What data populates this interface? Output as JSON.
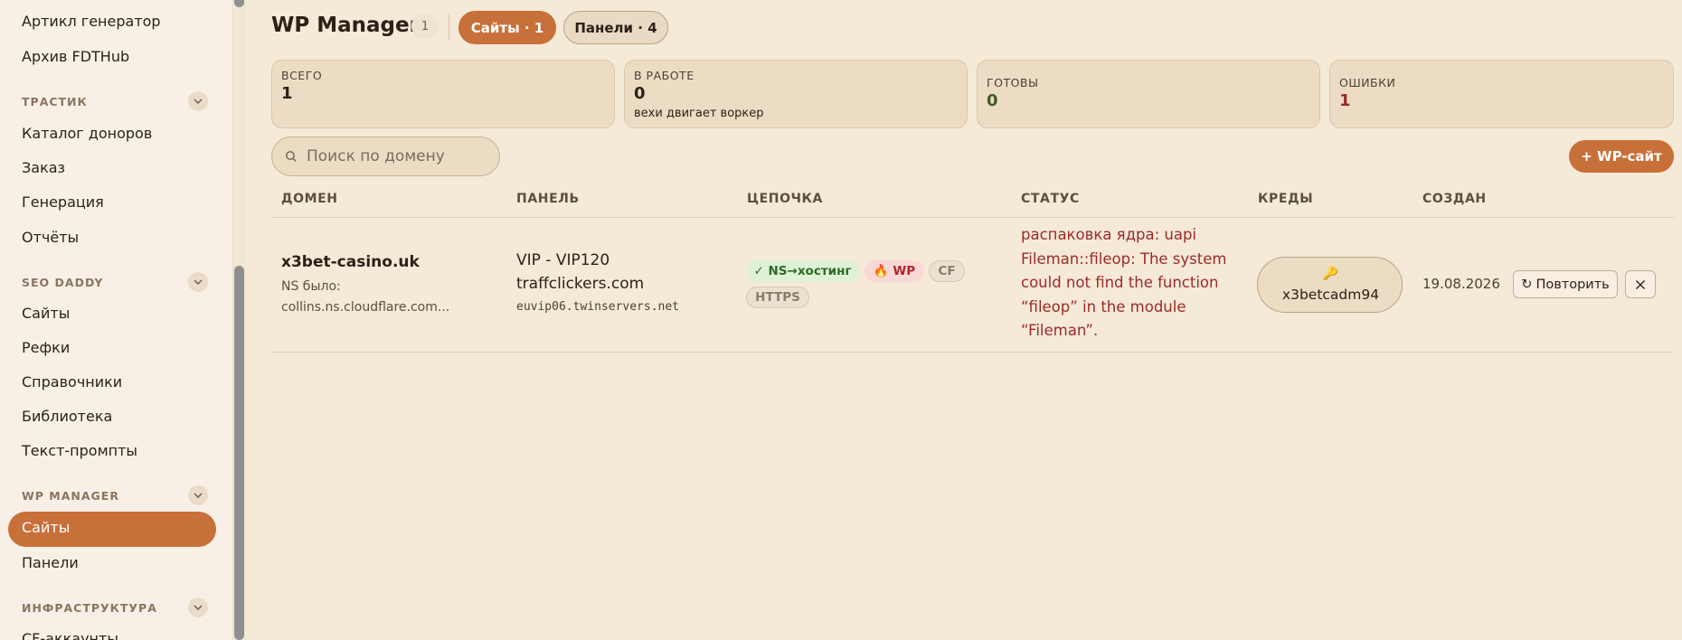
{
  "sidebar": {
    "items_top": [
      "Артикл генератор",
      "Архив FDTHub"
    ],
    "sections": [
      {
        "label": "ТРАСТИК",
        "items": [
          "Каталог доноров",
          "Заказ",
          "Генерация",
          "Отчёты"
        ]
      },
      {
        "label": "SEO DADDY",
        "items": [
          "Сайты",
          "Рефки",
          "Справочники",
          "Библиотека",
          "Текст-промпты"
        ]
      },
      {
        "label": "WP MANAGER",
        "items": [
          "Сайты",
          "Панели"
        ],
        "active": "Сайты"
      },
      {
        "label": "ИНФРАСТРУКТУРА",
        "items": [
          "CF-аккаунты"
        ]
      }
    ]
  },
  "header": {
    "title": "WP Manager",
    "count": "1",
    "tabs": [
      {
        "label": "Сайты · 1",
        "active": true
      },
      {
        "label": "Панели · 4",
        "active": false
      }
    ]
  },
  "stats": [
    {
      "label": "ВСЕГО",
      "value": "1",
      "sub": "",
      "color": "#2b2118"
    },
    {
      "label": "В РАБОТЕ",
      "value": "0",
      "sub": "вехи двигает воркер",
      "color": "#2b2118"
    },
    {
      "label": "ГОТОВЫ",
      "value": "0",
      "sub": "",
      "color": "#3e5a22"
    },
    {
      "label": "ОШИБКИ",
      "value": "1",
      "sub": "",
      "color": "#9c2a25"
    }
  ],
  "search": {
    "placeholder": "Поиск по домену",
    "value": ""
  },
  "add_button": "+ WP-сайт",
  "table": {
    "columns": [
      "ДОМЕН",
      "ПАНЕЛЬ",
      "ЦЕПОЧКА",
      "СТАТУС",
      "КРЕДЫ",
      "СОЗДАН"
    ],
    "rows": [
      {
        "domain": "x3bet-casino.uk",
        "ns_label": "NS было:",
        "ns_value": "collins.ns.cloudflare.com...",
        "panel_name": "VIP - VIP120",
        "panel_host": "traffclickers.com",
        "panel_server": "euvip06.twinservers.net",
        "chain": {
          "ns": "✓ NS→хостинг",
          "wp": "🔥 WP",
          "cf": "CF",
          "https": "HTTPS"
        },
        "status": "распаковка ядра: uapi Fileman::fileop: The system could not find the function “fileop” in the module “Fileman”.",
        "creds": "x3betcadm94",
        "created": "19.08.2026",
        "retry_label": "Повторить"
      }
    ]
  },
  "colors": {
    "accent": "#c8703a",
    "error": "#9c2a25",
    "background": "#f5e9d8"
  }
}
